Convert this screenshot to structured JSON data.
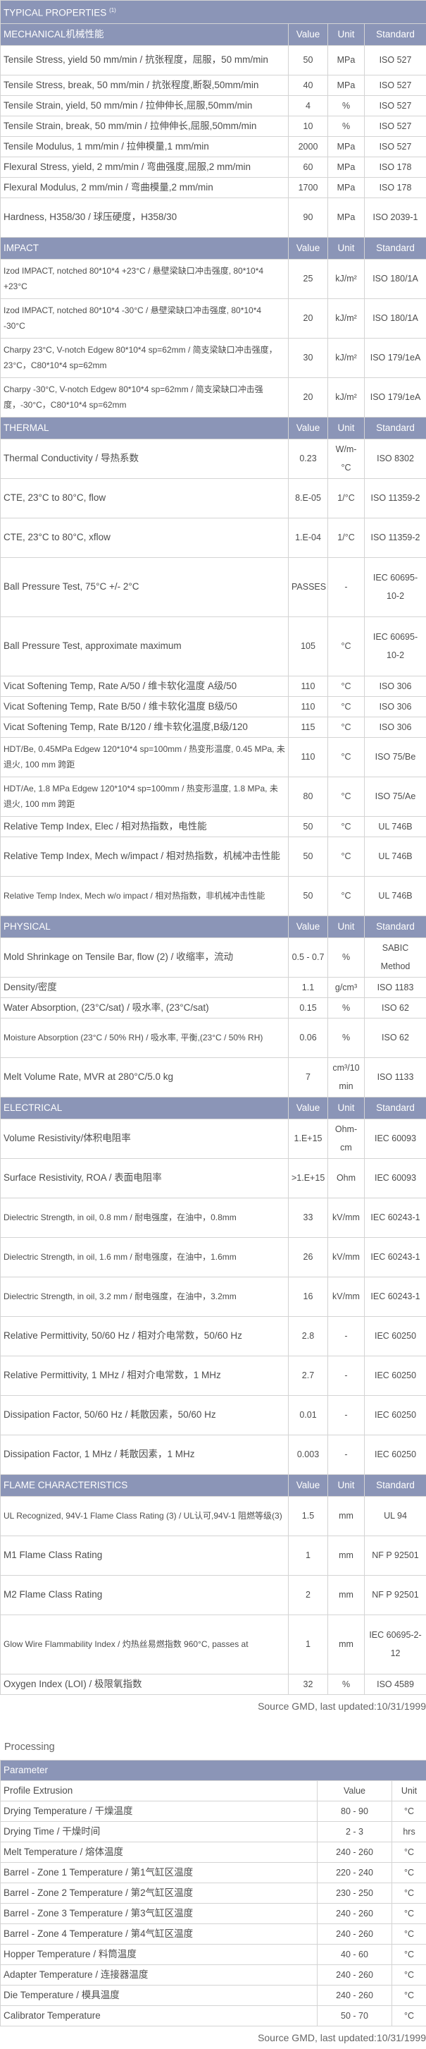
{
  "properties": {
    "title": "TYPICAL PROPERTIES",
    "title_note": "(1)",
    "sections": [
      {
        "name": "MECHANICAL机械性能",
        "headers": [
          "Value",
          "Unit",
          "Standard"
        ],
        "rows": [
          {
            "property": "Tensile Stress, yield 50 mm/min / 抗张程度，屈服，50 mm/min",
            "value": "50",
            "unit": "MPa",
            "standard": "ISO 527",
            "h": 42
          },
          {
            "property": "Tensile Stress, break, 50 mm/min / 抗张程度,断裂,50mm/min",
            "value": "40",
            "unit": "MPa",
            "standard": "ISO 527",
            "h": 28
          },
          {
            "property": "Tensile Strain, yield, 50 mm/min / 拉伸伸长,屈服,50mm/min",
            "value": "4",
            "unit": "%",
            "standard": "ISO 527",
            "h": 28
          },
          {
            "property": "Tensile Strain, break, 50 mm/min / 拉伸伸长,屈服,50mm/min",
            "value": "10",
            "unit": "%",
            "standard": "ISO 527",
            "h": 28
          },
          {
            "property": "Tensile Modulus, 1 mm/min / 拉伸模量,1 mm/min",
            "value": "2000",
            "unit": "MPa",
            "standard": "ISO 527",
            "h": 28
          },
          {
            "property": "Flexural Stress, yield, 2 mm/min / 弯曲强度,屈服,2 mm/min",
            "value": "60",
            "unit": "MPa",
            "standard": "ISO 178",
            "h": 28
          },
          {
            "property": "Flexural Modulus, 2 mm/min / 弯曲模量,2 mm/min",
            "value": "1700",
            "unit": "MPa",
            "standard": "ISO 178",
            "h": 28
          },
          {
            "property": "Hardness, H358/30 / 球压硬度，H358/30",
            "value": "90",
            "unit": "MPa",
            "standard": "ISO 2039-1",
            "h": 56
          }
        ]
      },
      {
        "name": "IMPACT",
        "headers": [
          "Value",
          "Unit",
          "Standard"
        ],
        "rows": [
          {
            "property": "Izod IMPACT, notched 80*10*4 +23°C / 悬壁梁缺口冲击强度, 80*10*4 +23°C",
            "value": "25",
            "unit": "kJ/m²",
            "standard": "ISO 180/1A",
            "h": 56
          },
          {
            "property": "Izod IMPACT, notched 80*10*4 -30°C / 悬壁梁缺口冲击强度, 80*10*4 -30°C",
            "value": "20",
            "unit": "kJ/m²",
            "standard": "ISO 180/1A",
            "h": 56
          },
          {
            "property": "Charpy 23°C, V-notch Edgew 80*10*4 sp=62mm / 简支梁缺口冲击强度，23°C，C80*10*4 sp=62mm",
            "value": "30",
            "unit": "kJ/m²",
            "standard": "ISO 179/1eA",
            "h": 56
          },
          {
            "property": "Charpy -30°C, V-notch Edgew 80*10*4 sp=62mm / 简支梁缺口冲击强度，-30°C，C80*10*4 sp=62mm",
            "value": "20",
            "unit": "kJ/m²",
            "standard": "ISO 179/1eA",
            "h": 56
          }
        ]
      },
      {
        "name": "THERMAL",
        "headers": [
          "Value",
          "Unit",
          "Standard"
        ],
        "rows": [
          {
            "property": "Thermal Conductivity / 导热系数",
            "value": "0.23",
            "unit": "W/m-°C",
            "standard": "ISO 8302",
            "h": 56
          },
          {
            "property": "CTE, 23°C to 80°C, flow",
            "value": "8.E-05",
            "unit": "1/°C",
            "standard": "ISO 11359-2",
            "h": 56
          },
          {
            "property": "CTE, 23°C to 80°C, xflow",
            "value": "1.E-04",
            "unit": "1/°C",
            "standard": "ISO 11359-2",
            "h": 56
          },
          {
            "property": "Ball Pressure Test, 75°C +/- 2°C",
            "value": "PASSES",
            "unit": "-",
            "standard": "IEC 60695-10-2",
            "h": 84
          },
          {
            "property": "Ball Pressure Test, approximate maximum",
            "value": "105",
            "unit": "°C",
            "standard": "IEC 60695-10-2",
            "h": 84
          },
          {
            "property": "Vicat Softening Temp, Rate A/50 / 维卡软化温度 A级/50",
            "value": "110",
            "unit": "°C",
            "standard": "ISO 306",
            "h": 28
          },
          {
            "property": "Vicat Softening Temp, Rate B/50 / 维卡软化温度 B级/50",
            "value": "110",
            "unit": "°C",
            "standard": "ISO 306",
            "h": 28
          },
          {
            "property": "Vicat Softening Temp, Rate B/120 / 维卡软化温度,B级/120",
            "value": "115",
            "unit": "°C",
            "standard": "ISO 306",
            "h": 28
          },
          {
            "property": "HDT/Be, 0.45MPa Edgew 120*10*4 sp=100mm / 热变形温度, 0.45 MPa, 未退火, 100 mm 跨距",
            "value": "110",
            "unit": "°C",
            "standard": "ISO 75/Be",
            "h": 56
          },
          {
            "property": "HDT/Ae, 1.8 MPa Edgew 120*10*4 sp=100mm / 热变形温度, 1.8 MPa, 未退火, 100 mm 跨距",
            "value": "80",
            "unit": "°C",
            "standard": "ISO 75/Ae",
            "h": 56
          },
          {
            "property": "Relative Temp Index, Elec / 相对热指数，电性能",
            "value": "50",
            "unit": "°C",
            "standard": "UL 746B",
            "h": 28
          },
          {
            "property": "Relative Temp Index, Mech w/impact / 相对热指数，机械冲击性能",
            "value": "50",
            "unit": "°C",
            "standard": "UL 746B",
            "h": 56
          },
          {
            "property": "Relative Temp Index, Mech w/o impact / 相对热指数，非机械冲击性能",
            "value": "50",
            "unit": "°C",
            "standard": "UL 746B",
            "h": 56
          }
        ]
      },
      {
        "name": "PHYSICAL",
        "headers": [
          "Value",
          "Unit",
          "Standard"
        ],
        "rows": [
          {
            "property": "Mold Shrinkage on Tensile Bar, flow (2) / 收缩率，流动",
            "value": "0.5 - 0.7",
            "unit": "%",
            "standard": "SABIC Method",
            "h": 56
          },
          {
            "property": "Density/密度",
            "value": "1.1",
            "unit": "g/cm³",
            "standard": "ISO 1183",
            "h": 28
          },
          {
            "property": "Water Absorption, (23°C/sat) / 吸水率, (23°C/sat)",
            "value": "0.15",
            "unit": "%",
            "standard": "ISO 62",
            "h": 28
          },
          {
            "property": "Moisture Absorption (23°C / 50% RH) / 吸水率, 平衡,(23°C / 50% RH)",
            "value": "0.06",
            "unit": "%",
            "standard": "ISO 62",
            "h": 56
          },
          {
            "property": "Melt Volume Rate, MVR at 280°C/5.0 kg",
            "value": "7",
            "unit": "cm³/10 min",
            "standard": "ISO 1133",
            "h": 56
          }
        ]
      },
      {
        "name": "ELECTRICAL",
        "headers": [
          "Value",
          "Unit",
          "Standard"
        ],
        "rows": [
          {
            "property": "Volume Resistivity/体积电阻率",
            "value": "1.E+15",
            "unit": "Ohm-cm",
            "standard": "IEC 60093",
            "h": 56
          },
          {
            "property": "Surface Resistivity, ROA / 表面电阻率",
            "value": ">1.E+15",
            "unit": "Ohm",
            "standard": "IEC 60093",
            "h": 56
          },
          {
            "property": "Dielectric Strength, in oil, 0.8 mm / 耐电强度，在油中，0.8mm",
            "value": "33",
            "unit": "kV/mm",
            "standard": "IEC 60243-1",
            "h": 56
          },
          {
            "property": "Dielectric Strength, in oil, 1.6 mm / 耐电强度，在油中，1.6mm",
            "value": "26",
            "unit": "kV/mm",
            "standard": "IEC 60243-1",
            "h": 56
          },
          {
            "property": "Dielectric Strength, in oil, 3.2 mm / 耐电强度，在油中，3.2mm",
            "value": "16",
            "unit": "kV/mm",
            "standard": "IEC 60243-1",
            "h": 56
          },
          {
            "property": "Relative Permittivity, 50/60 Hz / 相对介电常数，50/60 Hz",
            "value": "2.8",
            "unit": "-",
            "standard": "IEC 60250",
            "h": 56
          },
          {
            "property": "Relative Permittivity, 1 MHz / 相对介电常数，1 MHz",
            "value": "2.7",
            "unit": "-",
            "standard": "IEC 60250",
            "h": 56
          },
          {
            "property": "Dissipation Factor, 50/60 Hz / 耗散因素，50/60 Hz",
            "value": "0.01",
            "unit": "-",
            "standard": "IEC 60250",
            "h": 56
          },
          {
            "property": "Dissipation Factor, 1 MHz / 耗散因素，1 MHz",
            "value": "0.003",
            "unit": "-",
            "standard": "IEC 60250",
            "h": 56
          }
        ]
      },
      {
        "name": "FLAME CHARACTERISTICS",
        "headers": [
          "Value",
          "Unit",
          "Standard"
        ],
        "rows": [
          {
            "property": "UL Recognized, 94V-1 Flame Class Rating (3) / UL认可,94V-1 阻燃等级(3)",
            "value": "1.5",
            "unit": "mm",
            "standard": "UL 94",
            "h": 56
          },
          {
            "property": "M1 Flame Class Rating",
            "value": "1",
            "unit": "mm",
            "standard": "NF P 92501",
            "h": 56
          },
          {
            "property": "M2 Flame Class Rating",
            "value": "2",
            "unit": "mm",
            "standard": "NF P 92501",
            "h": 56
          },
          {
            "property": "Glow Wire Flammability Index / 灼热丝易燃指数 960°C, passes at",
            "value": "1",
            "unit": "mm",
            "standard": "IEC 60695-2-12",
            "h": 84
          },
          {
            "property": "Oxygen Index (LOI) / 极限氧指数",
            "value": "32",
            "unit": "%",
            "standard": "ISO 4589",
            "h": 28
          }
        ]
      }
    ],
    "source": "Source GMD, last updated:10/31/1999"
  },
  "processing": {
    "title": "Processing",
    "param_label": "Parameter",
    "section_label": "Profile Extrusion",
    "headers": [
      "Value",
      "Unit"
    ],
    "rows": [
      {
        "name": "Drying Temperature / 干燥温度",
        "value": "80 - 90",
        "unit": "°C"
      },
      {
        "name": "Drying Time / 干燥时间",
        "value": "2 - 3",
        "unit": "hrs"
      },
      {
        "name": "Melt Temperature / 熔体温度",
        "value": "240 - 260",
        "unit": "°C"
      },
      {
        "name": "Barrel - Zone 1 Temperature / 第1气缸区温度",
        "value": "220 - 240",
        "unit": "°C"
      },
      {
        "name": "Barrel - Zone 2 Temperature / 第2气缸区温度",
        "value": "230 - 250",
        "unit": "°C"
      },
      {
        "name": "Barrel - Zone 3 Temperature / 第3气缸区温度",
        "value": "240 - 260",
        "unit": "°C"
      },
      {
        "name": "Barrel - Zone 4 Temperature / 第4气缸区温度",
        "value": "240 - 260",
        "unit": "°C"
      },
      {
        "name": "Hopper Temperature / 料筒温度",
        "value": "40 - 60",
        "unit": "°C"
      },
      {
        "name": "Adapter Temperature / 连接器温度",
        "value": "240 - 260",
        "unit": "°C"
      },
      {
        "name": "Die Temperature / 模具温度",
        "value": "240 - 260",
        "unit": "°C"
      },
      {
        "name": "Calibrator Temperature",
        "value": "50 - 70",
        "unit": "°C"
      }
    ],
    "source": "Source GMD, last updated:10/31/1999"
  }
}
